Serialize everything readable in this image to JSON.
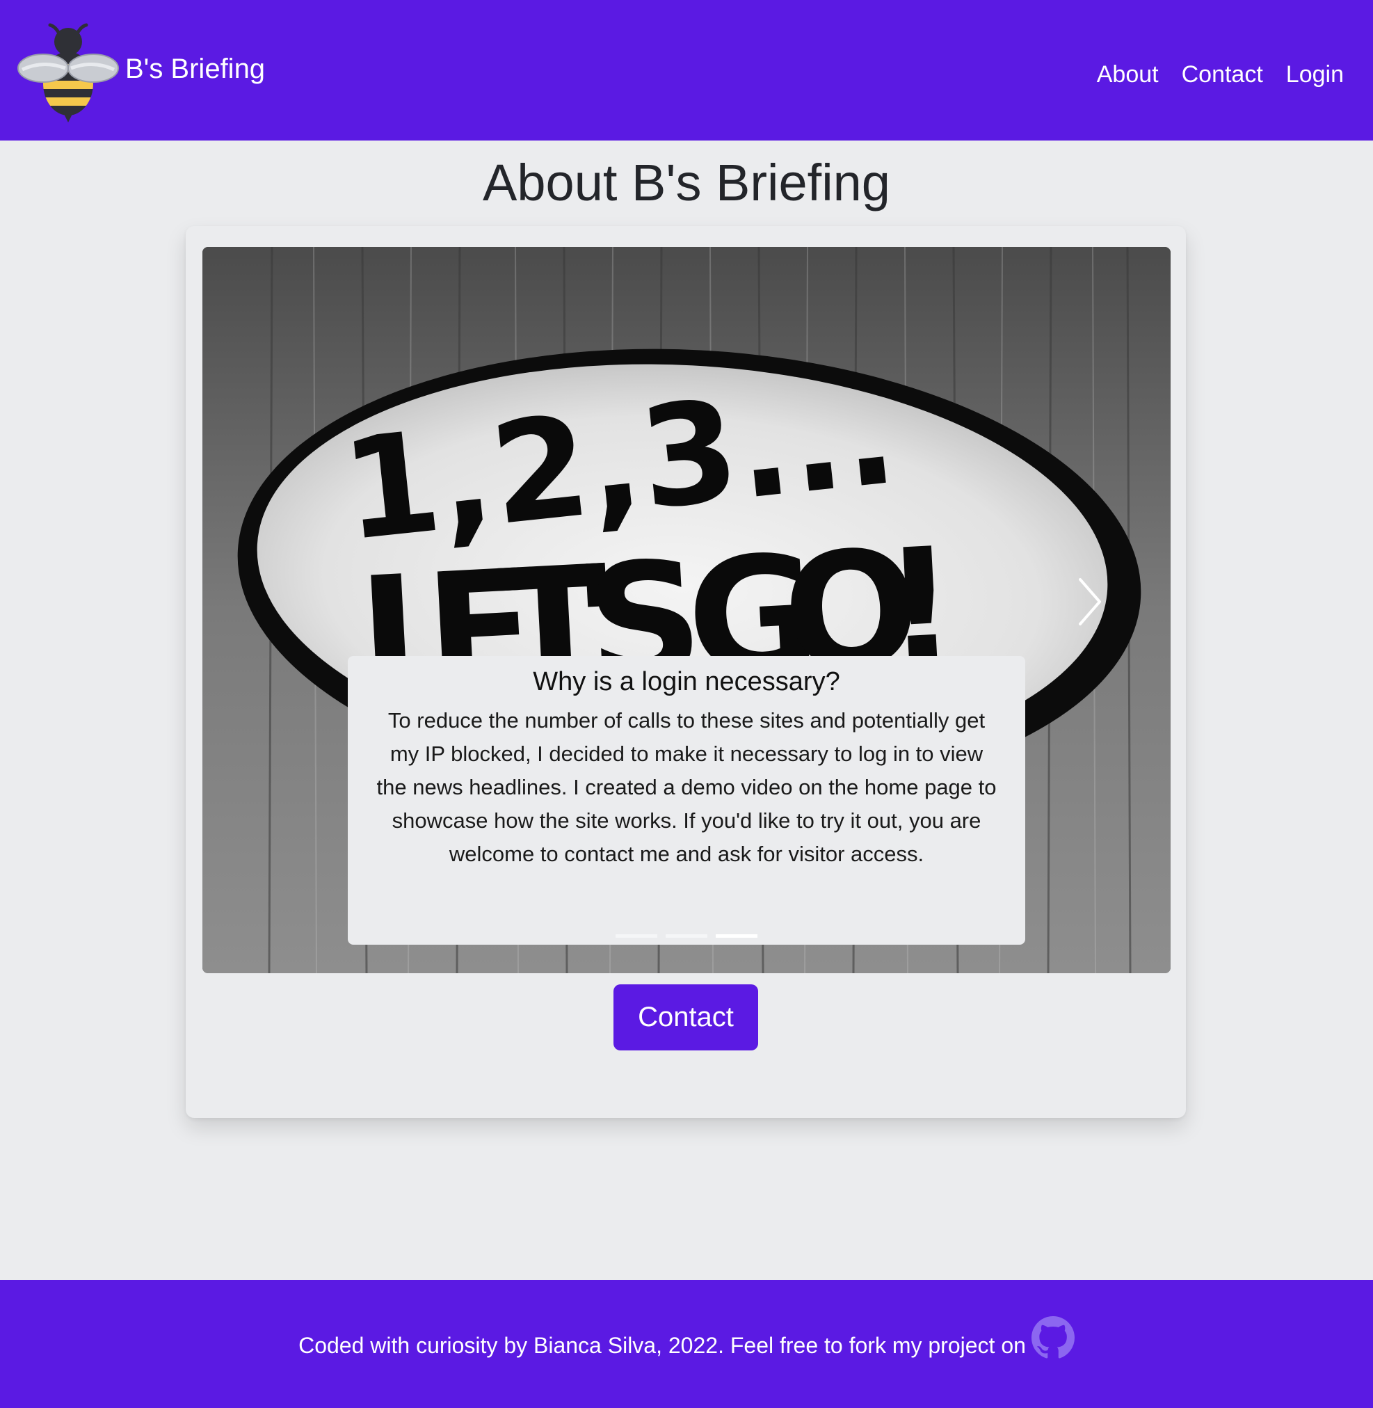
{
  "header": {
    "brand": "B's Briefing",
    "logo_icon": "bee-icon",
    "nav": [
      {
        "label": "About"
      },
      {
        "label": "Contact"
      },
      {
        "label": "Login"
      }
    ]
  },
  "main": {
    "title": "About B's Briefing",
    "carousel": {
      "image_text_line1": "1,2,3...",
      "image_text_line2": "LET'S GO!",
      "next_icon": "chevron-right-icon",
      "caption_title": "Why is a login necessary?",
      "caption_text": "To reduce the number of calls to these sites and potentially get my IP blocked, I decided to make it necessary to log in to view the news headlines. I created a demo video on the home page to showcase how the site works. If you'd like to try it out, you are welcome to contact me and ask for visitor access.",
      "slide_count": 3,
      "active_slide": 3
    },
    "contact_button": "Contact"
  },
  "footer": {
    "text": "Coded with curiosity by Bianca Silva, 2022. Feel free to fork my project on",
    "icon": "github-icon"
  },
  "colors": {
    "brand": "#5b1ae3",
    "background": "#ebecee",
    "text_dark": "#23252a",
    "bee_yellow": "#f5c84c",
    "bee_black": "#2f3036"
  }
}
